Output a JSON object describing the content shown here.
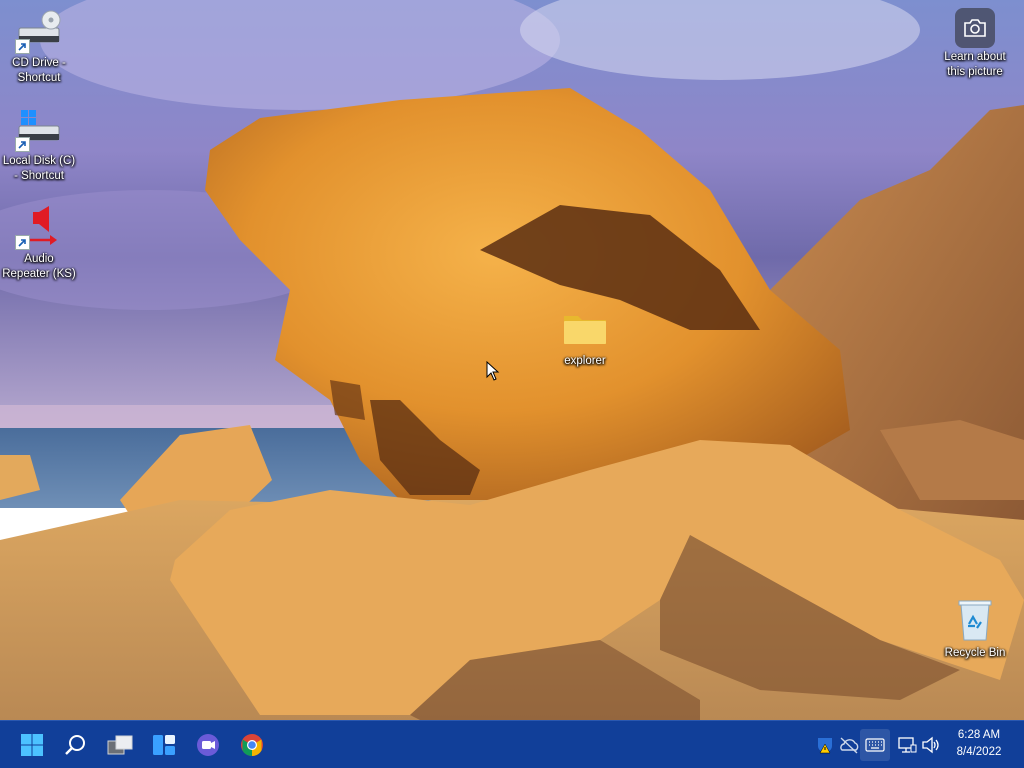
{
  "desktop": {
    "icons": [
      {
        "name": "cd-drive-shortcut",
        "label": "CD Drive - Shortcut"
      },
      {
        "name": "local-disk-shortcut",
        "label": "Local Disk (C) - Shortcut"
      },
      {
        "name": "audio-repeater",
        "label": "Audio Repeater (KS)"
      },
      {
        "name": "explorer-folder",
        "label": "explorer"
      },
      {
        "name": "recycle-bin",
        "label": "Recycle Bin"
      },
      {
        "name": "learn-about-picture",
        "label": "Learn about this picture"
      }
    ]
  },
  "taskbar": {
    "icons": [
      "windows-start-icon",
      "search-icon",
      "task-view-icon",
      "widgets-icon",
      "teams-chat-icon",
      "chrome-icon"
    ],
    "tray_icons": [
      "security-warning-icon",
      "onedrive-offline-icon",
      "touch-keyboard-icon",
      "network-icon",
      "volume-icon"
    ],
    "clock": {
      "time": "6:28 AM",
      "date": "8/4/2022"
    }
  },
  "colors": {
    "taskbar": "#113f99",
    "accent": "#0078d4"
  }
}
